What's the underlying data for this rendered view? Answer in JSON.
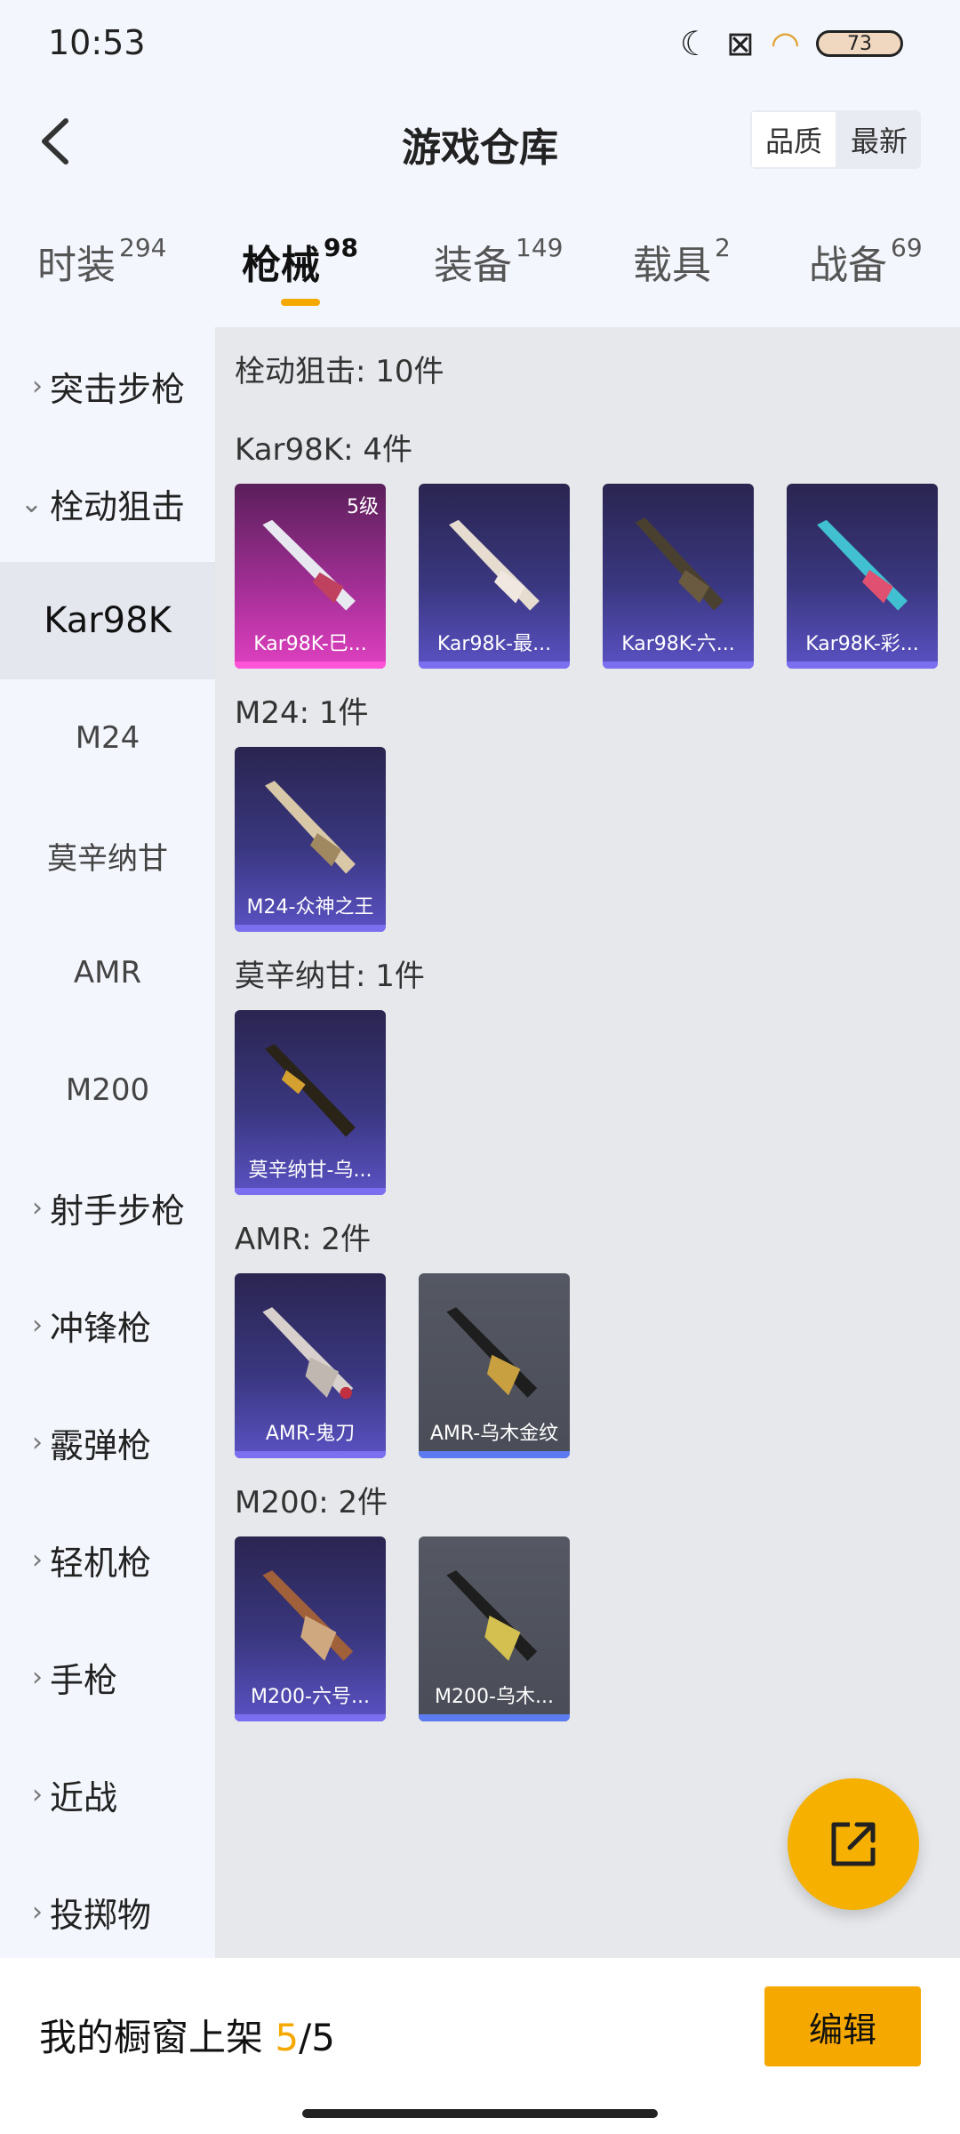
{
  "status": {
    "time": "10:53",
    "battery": "73"
  },
  "header": {
    "title": "游戏仓库",
    "sort_quality": "品质",
    "sort_latest": "最新"
  },
  "tabs": [
    {
      "label": "时装",
      "count": "294"
    },
    {
      "label": "枪械",
      "count": "98"
    },
    {
      "label": "装备",
      "count": "149"
    },
    {
      "label": "载具",
      "count": "2"
    },
    {
      "label": "战备",
      "count": "69"
    }
  ],
  "sidebar": {
    "items": [
      "突击步枪",
      "栓动狙击",
      "Kar98K",
      "M24",
      "莫辛纳甘",
      "AMR",
      "M200",
      "射手步枪",
      "冲锋枪",
      "霰弹枪",
      "轻机枪",
      "手枪",
      "近战",
      "投掷物"
    ]
  },
  "content": {
    "summary": "栓动狙击: 10件",
    "groups": [
      {
        "title": "Kar98K: 4件",
        "items": [
          {
            "name": "Kar98K-巳...",
            "level": "5级",
            "quality": "pink"
          },
          {
            "name": "Kar98k-最...",
            "quality": "purple"
          },
          {
            "name": "Kar98K-六...",
            "quality": "purple"
          },
          {
            "name": "Kar98K-彩...",
            "quality": "purple"
          }
        ]
      },
      {
        "title": "M24: 1件",
        "items": [
          {
            "name": "M24-众神之王",
            "quality": "purple"
          }
        ]
      },
      {
        "title": "莫辛纳甘: 1件",
        "items": [
          {
            "name": "莫辛纳甘-乌...",
            "quality": "purple"
          }
        ]
      },
      {
        "title": "AMR: 2件",
        "items": [
          {
            "name": "AMR-鬼刀",
            "quality": "purple"
          },
          {
            "name": "AMR-乌木金纹",
            "quality": "gray"
          }
        ]
      },
      {
        "title": "M200: 2件",
        "items": [
          {
            "name": "M200-六号...",
            "quality": "purple"
          },
          {
            "name": "M200-乌木...",
            "quality": "gray"
          }
        ]
      }
    ]
  },
  "bottom": {
    "shelf_label": "我的橱窗上架",
    "shelf_current": "5",
    "shelf_total": "/5",
    "edit_label": "编辑"
  },
  "colors": {
    "accent": "#f5a800",
    "purple_card": "#3a3780",
    "pink_card": "#a8309a",
    "gray_card": "#4a4d57"
  }
}
